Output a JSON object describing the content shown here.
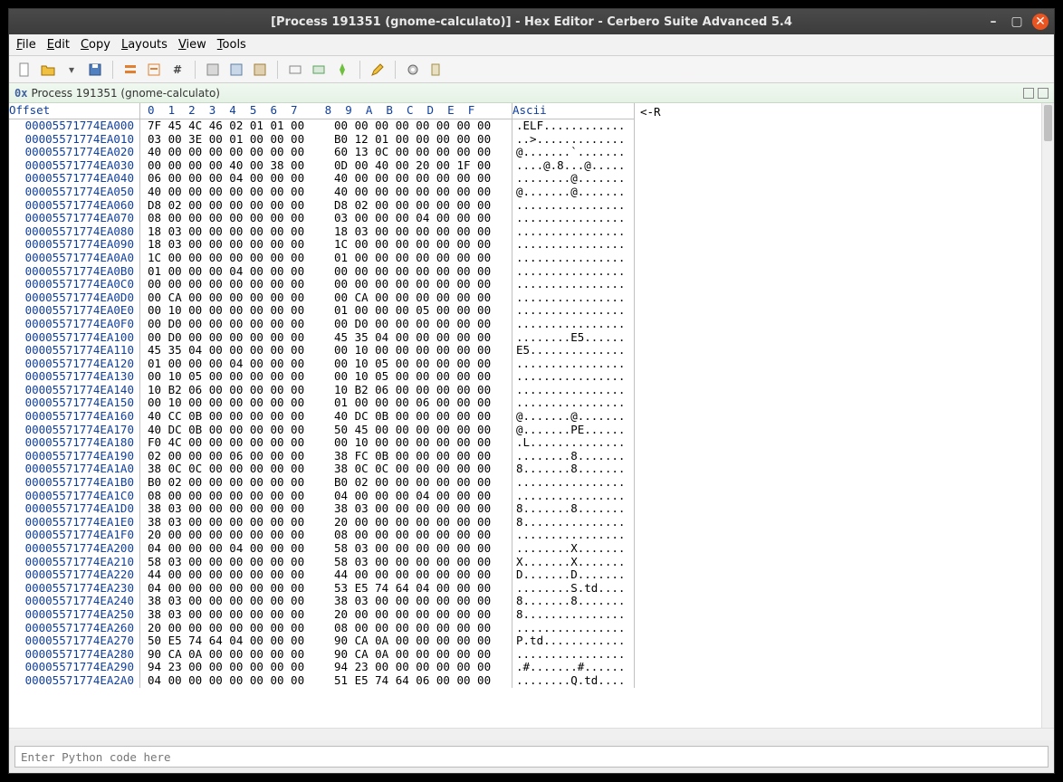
{
  "window": {
    "title": "[Process 191351 (gnome-calculato)] - Hex Editor - Cerbero Suite Advanced 5.4"
  },
  "menubar": {
    "items": [
      "File",
      "Edit",
      "Copy",
      "Layouts",
      "View",
      "Tools"
    ]
  },
  "docbar": {
    "prefix": "0x",
    "title": "Process 191351 (gnome-calculato)"
  },
  "header": {
    "offset": "Offset",
    "cols": "0  1  2  3  4  5  6  7    8  9  A  B  C  D  E  F",
    "ascii": "Ascii"
  },
  "right_panel": {
    "text": "<-R"
  },
  "python": {
    "placeholder": "Enter Python code here"
  },
  "rows": [
    {
      "o": "00005571774EA000",
      "h1": "7F 45 4C 46 02 01 01 00",
      "h2": "00 00 00 00 00 00 00 00",
      "a": ".ELF............"
    },
    {
      "o": "00005571774EA010",
      "h1": "03 00 3E 00 01 00 00 00",
      "h2": "B0 12 01 00 00 00 00 00",
      "a": "..>............."
    },
    {
      "o": "00005571774EA020",
      "h1": "40 00 00 00 00 00 00 00",
      "h2": "60 13 0C 00 00 00 00 00",
      "a": "@.......`......."
    },
    {
      "o": "00005571774EA030",
      "h1": "00 00 00 00 40 00 38 00",
      "h2": "0D 00 40 00 20 00 1F 00",
      "a": "....@.8...@....."
    },
    {
      "o": "00005571774EA040",
      "h1": "06 00 00 00 04 00 00 00",
      "h2": "40 00 00 00 00 00 00 00",
      "a": "........@......."
    },
    {
      "o": "00005571774EA050",
      "h1": "40 00 00 00 00 00 00 00",
      "h2": "40 00 00 00 00 00 00 00",
      "a": "@.......@......."
    },
    {
      "o": "00005571774EA060",
      "h1": "D8 02 00 00 00 00 00 00",
      "h2": "D8 02 00 00 00 00 00 00",
      "a": "................"
    },
    {
      "o": "00005571774EA070",
      "h1": "08 00 00 00 00 00 00 00",
      "h2": "03 00 00 00 04 00 00 00",
      "a": "................"
    },
    {
      "o": "00005571774EA080",
      "h1": "18 03 00 00 00 00 00 00",
      "h2": "18 03 00 00 00 00 00 00",
      "a": "................"
    },
    {
      "o": "00005571774EA090",
      "h1": "18 03 00 00 00 00 00 00",
      "h2": "1C 00 00 00 00 00 00 00",
      "a": "................"
    },
    {
      "o": "00005571774EA0A0",
      "h1": "1C 00 00 00 00 00 00 00",
      "h2": "01 00 00 00 00 00 00 00",
      "a": "................"
    },
    {
      "o": "00005571774EA0B0",
      "h1": "01 00 00 00 04 00 00 00",
      "h2": "00 00 00 00 00 00 00 00",
      "a": "................"
    },
    {
      "o": "00005571774EA0C0",
      "h1": "00 00 00 00 00 00 00 00",
      "h2": "00 00 00 00 00 00 00 00",
      "a": "................"
    },
    {
      "o": "00005571774EA0D0",
      "h1": "00 CA 00 00 00 00 00 00",
      "h2": "00 CA 00 00 00 00 00 00",
      "a": "................"
    },
    {
      "o": "00005571774EA0E0",
      "h1": "00 10 00 00 00 00 00 00",
      "h2": "01 00 00 00 05 00 00 00",
      "a": "................"
    },
    {
      "o": "00005571774EA0F0",
      "h1": "00 D0 00 00 00 00 00 00",
      "h2": "00 D0 00 00 00 00 00 00",
      "a": "................"
    },
    {
      "o": "00005571774EA100",
      "h1": "00 D0 00 00 00 00 00 00",
      "h2": "45 35 04 00 00 00 00 00",
      "a": "........E5......"
    },
    {
      "o": "00005571774EA110",
      "h1": "45 35 04 00 00 00 00 00",
      "h2": "00 10 00 00 00 00 00 00",
      "a": "E5.............."
    },
    {
      "o": "00005571774EA120",
      "h1": "01 00 00 00 04 00 00 00",
      "h2": "00 10 05 00 00 00 00 00",
      "a": "................"
    },
    {
      "o": "00005571774EA130",
      "h1": "00 10 05 00 00 00 00 00",
      "h2": "00 10 05 00 00 00 00 00",
      "a": "................"
    },
    {
      "o": "00005571774EA140",
      "h1": "10 B2 06 00 00 00 00 00",
      "h2": "10 B2 06 00 00 00 00 00",
      "a": "................"
    },
    {
      "o": "00005571774EA150",
      "h1": "00 10 00 00 00 00 00 00",
      "h2": "01 00 00 00 06 00 00 00",
      "a": "................"
    },
    {
      "o": "00005571774EA160",
      "h1": "40 CC 0B 00 00 00 00 00",
      "h2": "40 DC 0B 00 00 00 00 00",
      "a": "@.......@......."
    },
    {
      "o": "00005571774EA170",
      "h1": "40 DC 0B 00 00 00 00 00",
      "h2": "50 45 00 00 00 00 00 00",
      "a": "@.......PE......"
    },
    {
      "o": "00005571774EA180",
      "h1": "F0 4C 00 00 00 00 00 00",
      "h2": "00 10 00 00 00 00 00 00",
      "a": ".L.............."
    },
    {
      "o": "00005571774EA190",
      "h1": "02 00 00 00 06 00 00 00",
      "h2": "38 FC 0B 00 00 00 00 00",
      "a": "........8......."
    },
    {
      "o": "00005571774EA1A0",
      "h1": "38 0C 0C 00 00 00 00 00",
      "h2": "38 0C 0C 00 00 00 00 00",
      "a": "8.......8......."
    },
    {
      "o": "00005571774EA1B0",
      "h1": "B0 02 00 00 00 00 00 00",
      "h2": "B0 02 00 00 00 00 00 00",
      "a": "................"
    },
    {
      "o": "00005571774EA1C0",
      "h1": "08 00 00 00 00 00 00 00",
      "h2": "04 00 00 00 04 00 00 00",
      "a": "................"
    },
    {
      "o": "00005571774EA1D0",
      "h1": "38 03 00 00 00 00 00 00",
      "h2": "38 03 00 00 00 00 00 00",
      "a": "8.......8......."
    },
    {
      "o": "00005571774EA1E0",
      "h1": "38 03 00 00 00 00 00 00",
      "h2": "20 00 00 00 00 00 00 00",
      "a": "8..............."
    },
    {
      "o": "00005571774EA1F0",
      "h1": "20 00 00 00 00 00 00 00",
      "h2": "08 00 00 00 00 00 00 00",
      "a": "................"
    },
    {
      "o": "00005571774EA200",
      "h1": "04 00 00 00 04 00 00 00",
      "h2": "58 03 00 00 00 00 00 00",
      "a": "........X......."
    },
    {
      "o": "00005571774EA210",
      "h1": "58 03 00 00 00 00 00 00",
      "h2": "58 03 00 00 00 00 00 00",
      "a": "X.......X......."
    },
    {
      "o": "00005571774EA220",
      "h1": "44 00 00 00 00 00 00 00",
      "h2": "44 00 00 00 00 00 00 00",
      "a": "D.......D......."
    },
    {
      "o": "00005571774EA230",
      "h1": "04 00 00 00 00 00 00 00",
      "h2": "53 E5 74 64 04 00 00 00",
      "a": "........S.td...."
    },
    {
      "o": "00005571774EA240",
      "h1": "38 03 00 00 00 00 00 00",
      "h2": "38 03 00 00 00 00 00 00",
      "a": "8.......8......."
    },
    {
      "o": "00005571774EA250",
      "h1": "38 03 00 00 00 00 00 00",
      "h2": "20 00 00 00 00 00 00 00",
      "a": "8..............."
    },
    {
      "o": "00005571774EA260",
      "h1": "20 00 00 00 00 00 00 00",
      "h2": "08 00 00 00 00 00 00 00",
      "a": "................"
    },
    {
      "o": "00005571774EA270",
      "h1": "50 E5 74 64 04 00 00 00",
      "h2": "90 CA 0A 00 00 00 00 00",
      "a": "P.td............"
    },
    {
      "o": "00005571774EA280",
      "h1": "90 CA 0A 00 00 00 00 00",
      "h2": "90 CA 0A 00 00 00 00 00",
      "a": "................"
    },
    {
      "o": "00005571774EA290",
      "h1": "94 23 00 00 00 00 00 00",
      "h2": "94 23 00 00 00 00 00 00",
      "a": ".#.......#......"
    },
    {
      "o": "00005571774EA2A0",
      "h1": "04 00 00 00 00 00 00 00",
      "h2": "51 E5 74 64 06 00 00 00",
      "a": "........Q.td...."
    }
  ]
}
